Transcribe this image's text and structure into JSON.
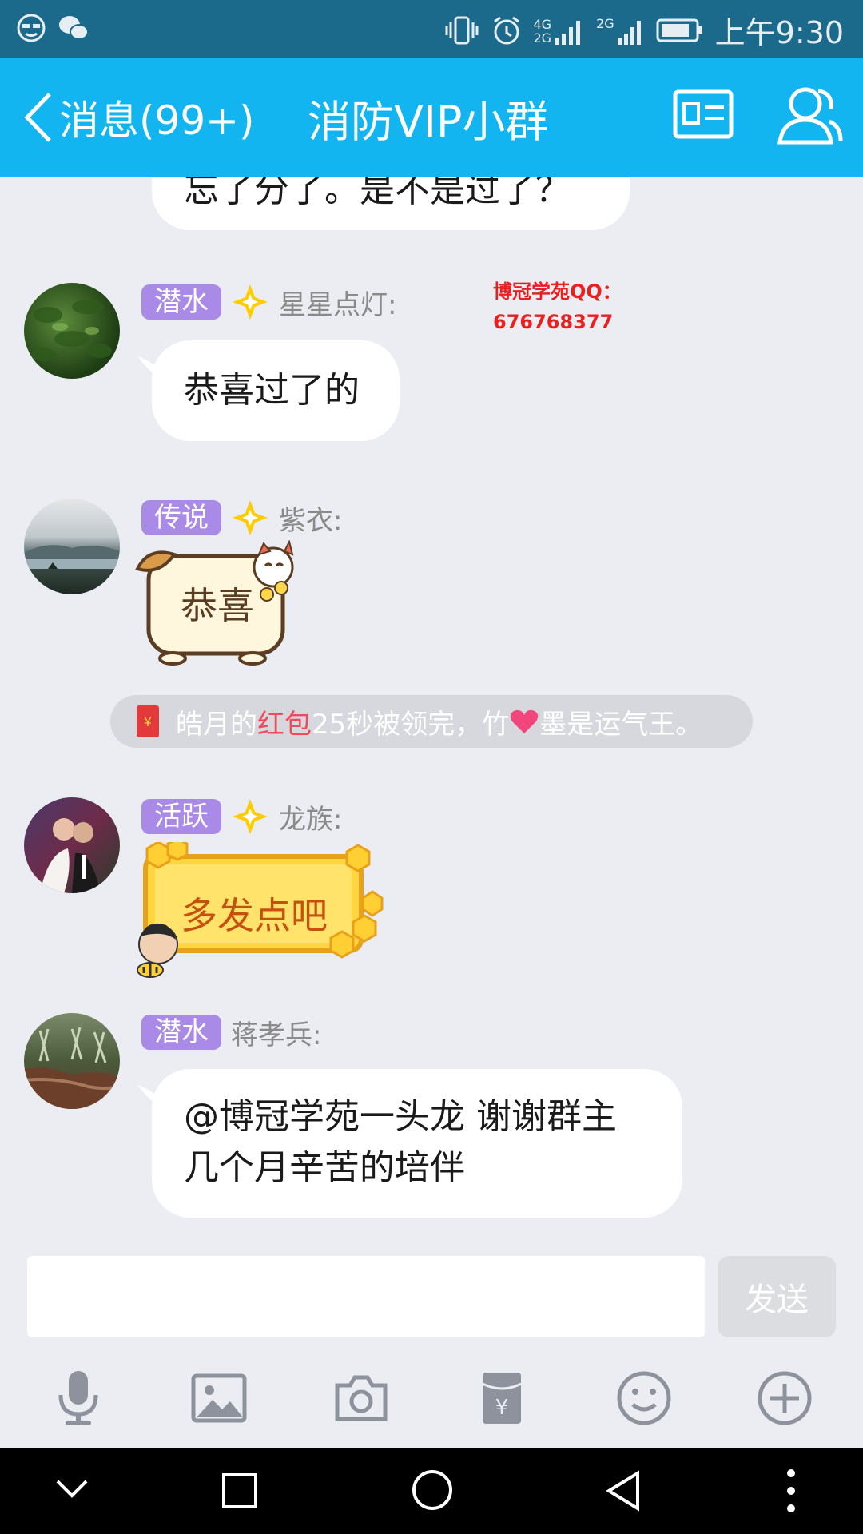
{
  "statusbar": {
    "signal_4g": "4G",
    "signal_2g_a": "2G",
    "signal_2g_b": "2G",
    "time": "上午9:30"
  },
  "header": {
    "back_label": "消息(99+)",
    "title": "消防VIP小群"
  },
  "chat": {
    "cut_message": "忘了分了。是不是过了？",
    "watermark_line1": "博冠学苑QQ：",
    "watermark_line2": "676768377",
    "messages": [
      {
        "badge": "潜水",
        "nick": "星星点灯:",
        "text": "恭喜过了的"
      },
      {
        "badge": "传说",
        "nick": "紫衣:",
        "text": "恭喜"
      },
      {
        "badge": "活跃",
        "nick": "龙族:",
        "text": "多发点吧"
      },
      {
        "badge": "潜水",
        "nick": "蒋孝兵:",
        "text_line1": "@博冠学苑一头龙 谢谢群主",
        "text_line2": "几个月辛苦的培伴"
      }
    ],
    "system": {
      "part1": "皓月的",
      "red_packet": "红包",
      "part2": "25秒被领完，竹",
      "part3": "墨是运气王。"
    }
  },
  "input": {
    "placeholder": "",
    "send_label": "发送"
  },
  "toolbar": {
    "items": [
      "voice-icon",
      "image-icon",
      "camera-icon",
      "red-packet-icon",
      "emoji-icon",
      "plus-icon"
    ]
  },
  "colors": {
    "header_bg": "#12b5f0",
    "statusbar_bg": "#1b6a8c",
    "badge_bg": "#a98ae6",
    "chat_bg": "#ebedf2",
    "red_accent": "#e8201f",
    "star_yellow": "#ffcc00"
  }
}
